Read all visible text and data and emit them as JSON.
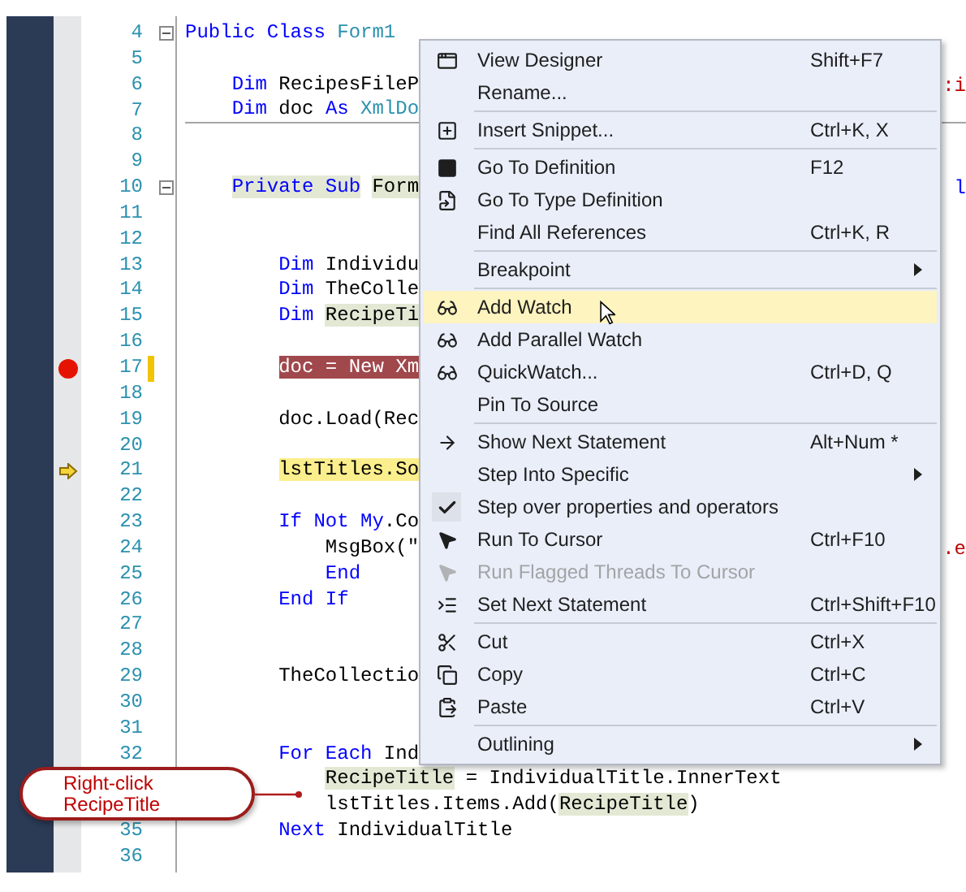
{
  "editor": {
    "lines": [
      {
        "number": "4",
        "fold": true,
        "tokens": [
          {
            "text": "Public Class ",
            "kind": "kw"
          },
          {
            "text": "Form1",
            "kind": "type"
          }
        ]
      },
      {
        "number": "5"
      },
      {
        "number": "6",
        "tokens": [
          {
            "text": "    Dim",
            "kind": "kw"
          },
          {
            "text": " RecipesFileP",
            "kind": "plain"
          }
        ],
        "tail": {
          "text": ":i",
          "kind": "str"
        }
      },
      {
        "number": "7",
        "separator": true,
        "tokens": [
          {
            "text": "    Dim",
            "kind": "kw"
          },
          {
            "text": " doc ",
            "kind": "plain"
          },
          {
            "text": "As ",
            "kind": "kw"
          },
          {
            "text": "XmlDo",
            "kind": "type"
          }
        ]
      },
      {
        "number": "8"
      },
      {
        "number": "9"
      },
      {
        "number": "10",
        "fold": true,
        "tokens": [
          {
            "text": "    Private Sub",
            "kind": "kwref"
          },
          {
            "text": " Form",
            "kind": "ref"
          }
        ],
        "tail": {
          "text": "l",
          "kind": "kw"
        }
      },
      {
        "number": "11"
      },
      {
        "number": "12"
      },
      {
        "number": "13",
        "tokens": [
          {
            "text": "        Dim",
            "kind": "kw"
          },
          {
            "text": " Individu",
            "kind": "plain"
          }
        ]
      },
      {
        "number": "14",
        "tokens": [
          {
            "text": "        Dim",
            "kind": "kw"
          },
          {
            "text": " TheColle",
            "kind": "plain"
          }
        ]
      },
      {
        "number": "15",
        "tokens": [
          {
            "text": "        Dim ",
            "kind": "kw"
          },
          {
            "text": "RecipeTi",
            "kind": "ref"
          }
        ]
      },
      {
        "number": "16"
      },
      {
        "number": "17",
        "breakpoint": true,
        "changed": true,
        "tokens": [
          {
            "text": "        doc = New Xm",
            "kind": "bp"
          }
        ]
      },
      {
        "number": "18"
      },
      {
        "number": "19",
        "tokens": [
          {
            "text": "        doc.Load(Rec",
            "kind": "plain"
          }
        ]
      },
      {
        "number": "20"
      },
      {
        "number": "21",
        "current": true,
        "tokens": [
          {
            "text": "        lstTitles.So",
            "kind": "cur"
          }
        ]
      },
      {
        "number": "22"
      },
      {
        "number": "23",
        "tokens": [
          {
            "text": "        If Not My",
            "kind": "kw"
          },
          {
            "text": ".Co",
            "kind": "plain"
          }
        ]
      },
      {
        "number": "24",
        "tokens": [
          {
            "text": "            MsgBox(\"",
            "kind": "plain"
          }
        ],
        "tail": {
          "text": ".e",
          "kind": "str"
        }
      },
      {
        "number": "25",
        "tokens": [
          {
            "text": "            End",
            "kind": "kw"
          }
        ]
      },
      {
        "number": "26",
        "tokens": [
          {
            "text": "        End If",
            "kind": "kw"
          }
        ]
      },
      {
        "number": "27"
      },
      {
        "number": "28"
      },
      {
        "number": "29",
        "tokens": [
          {
            "text": "        TheCollectio",
            "kind": "plain"
          }
        ]
      },
      {
        "number": "30"
      },
      {
        "number": "31"
      },
      {
        "number": "32",
        "tokens": [
          {
            "text": "        For Each",
            "kind": "kw"
          },
          {
            "text": " Ind",
            "kind": "plain"
          }
        ]
      },
      {
        "tokens": [
          {
            "text": "            RecipeTitle",
            "kind": "ref"
          },
          {
            "text": " = IndividualTitle.InnerText",
            "kind": "plain"
          }
        ]
      },
      {
        "tokens": [
          {
            "text": "            lstTitles.Items.Add(",
            "kind": "plain"
          },
          {
            "text": "RecipeTitle",
            "kind": "ref"
          },
          {
            "text": ")",
            "kind": "plain"
          }
        ]
      },
      {
        "number": "35",
        "tokens": [
          {
            "text": "        Next",
            "kind": "kw"
          },
          {
            "text": " IndividualTitle",
            "kind": "plain"
          }
        ]
      },
      {
        "number": "36"
      }
    ]
  },
  "context_menu": {
    "groups": [
      [
        {
          "label": "View Designer",
          "shortcut": "Shift+F7",
          "selected": false,
          "disabled": false,
          "checked": false,
          "submenu": false
        },
        {
          "label": "Rename...",
          "selected": false,
          "disabled": false,
          "checked": false,
          "submenu": false
        }
      ],
      [
        {
          "label": "Insert Snippet...",
          "shortcut": "Ctrl+K, X",
          "selected": false,
          "disabled": false,
          "checked": false,
          "submenu": false
        }
      ],
      [
        {
          "label": "Go To Definition",
          "shortcut": "F12",
          "selected": false,
          "disabled": false,
          "checked": false,
          "submenu": false
        },
        {
          "label": "Go To Type Definition",
          "selected": false,
          "disabled": false,
          "checked": false,
          "submenu": false
        },
        {
          "label": "Find All References",
          "shortcut": "Ctrl+K, R",
          "selected": false,
          "disabled": false,
          "checked": false,
          "submenu": false
        }
      ],
      [
        {
          "label": "Breakpoint",
          "selected": false,
          "disabled": false,
          "checked": false,
          "submenu": true
        }
      ],
      [
        {
          "label": "Add Watch",
          "selected": true,
          "disabled": false,
          "checked": false,
          "submenu": false
        },
        {
          "label": "Add Parallel Watch",
          "selected": false,
          "disabled": false,
          "checked": false,
          "submenu": false
        },
        {
          "label": "QuickWatch...",
          "shortcut": "Ctrl+D, Q",
          "selected": false,
          "disabled": false,
          "checked": false,
          "submenu": false
        },
        {
          "label": "Pin To Source",
          "selected": false,
          "disabled": false,
          "checked": false,
          "submenu": false
        }
      ],
      [
        {
          "label": "Show Next Statement",
          "shortcut": "Alt+Num *",
          "selected": false,
          "disabled": false,
          "checked": false,
          "submenu": false
        },
        {
          "label": "Step Into Specific",
          "selected": false,
          "disabled": false,
          "checked": false,
          "submenu": true
        },
        {
          "label": "Step over properties and operators",
          "selected": false,
          "disabled": false,
          "checked": true,
          "submenu": false
        },
        {
          "label": "Run To Cursor",
          "shortcut": "Ctrl+F10",
          "selected": false,
          "disabled": false,
          "checked": false,
          "submenu": false
        },
        {
          "label": "Run Flagged Threads To Cursor",
          "selected": false,
          "disabled": true,
          "checked": false,
          "submenu": false
        },
        {
          "label": "Set Next Statement",
          "shortcut": "Ctrl+Shift+F10",
          "selected": false,
          "disabled": false,
          "checked": false,
          "submenu": false
        }
      ],
      [
        {
          "label": "Cut",
          "shortcut": "Ctrl+X",
          "selected": false,
          "disabled": false,
          "checked": false,
          "submenu": false
        },
        {
          "label": "Copy",
          "shortcut": "Ctrl+C",
          "selected": false,
          "disabled": false,
          "checked": false,
          "submenu": false
        },
        {
          "label": "Paste",
          "shortcut": "Ctrl+V",
          "selected": false,
          "disabled": false,
          "checked": false,
          "submenu": false
        }
      ],
      [
        {
          "label": "Outlining",
          "selected": false,
          "disabled": false,
          "checked": false,
          "submenu": true
        }
      ]
    ]
  },
  "callout": {
    "text": "Right-click\nRecipeTitle"
  }
}
